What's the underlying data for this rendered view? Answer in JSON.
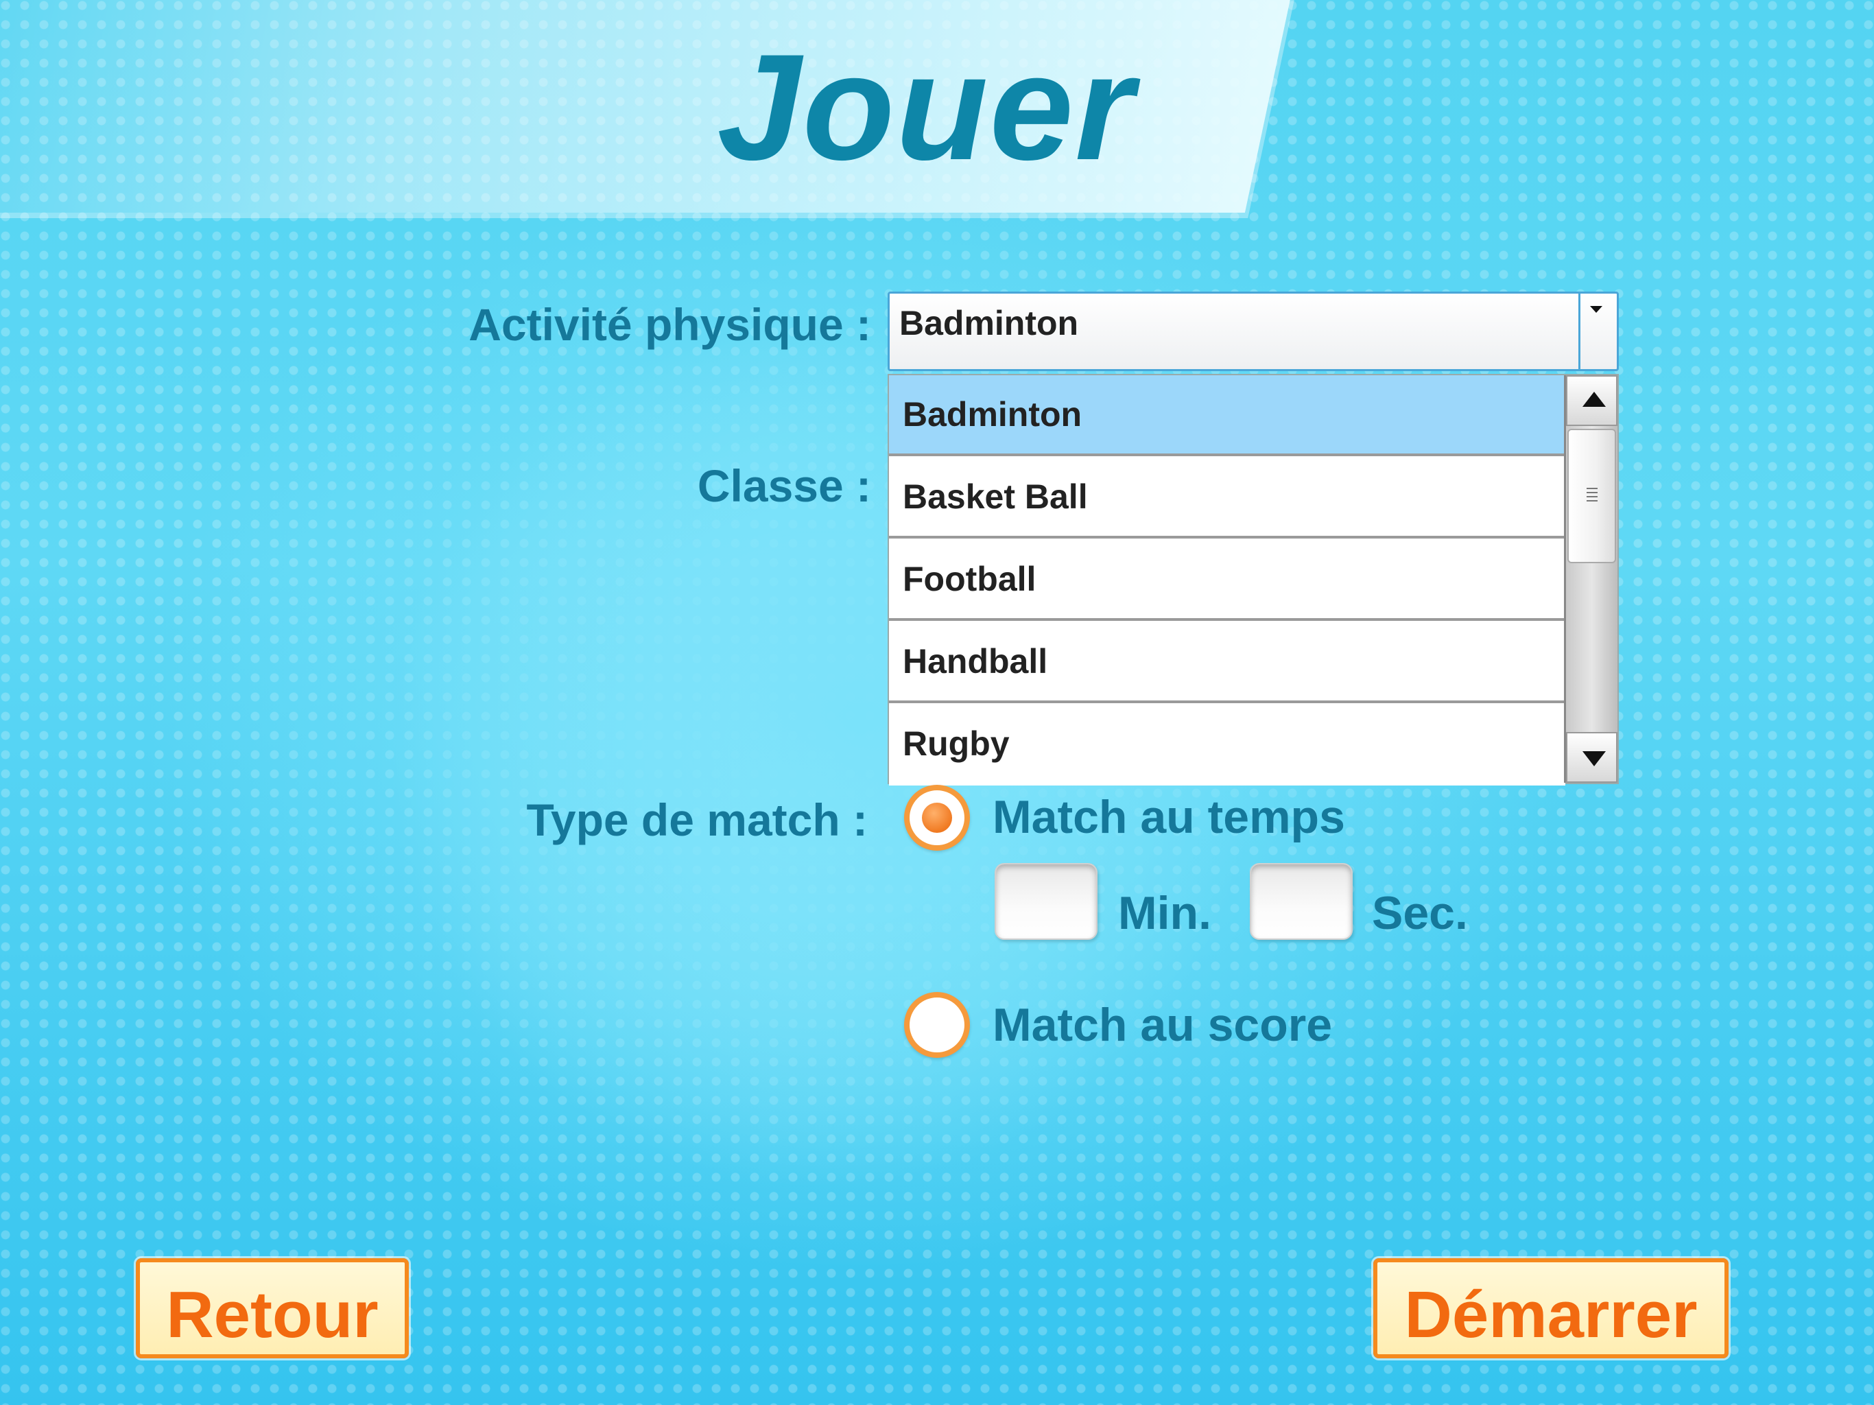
{
  "header": {
    "title": "Jouer"
  },
  "form": {
    "activity_label": "Activité physique :",
    "class_label": "Classe :",
    "match_type_label": "Type de match :"
  },
  "activity_select": {
    "selected": "Badminton",
    "options": [
      "Badminton",
      "Basket Ball",
      "Football",
      "Handball",
      "Rugby"
    ]
  },
  "match_type": {
    "time_option": "Match au temps",
    "score_option": "Match au score",
    "selected": "Match au temps",
    "minutes_unit": "Min.",
    "seconds_unit": "Sec.",
    "minutes_value": "",
    "seconds_value": ""
  },
  "footer": {
    "back_label": "Retour",
    "start_label": "Démarrer"
  },
  "colors": {
    "title": "#0e86a8",
    "label": "#15789a",
    "accent_orange": "#f58a1e",
    "selected_row": "#9cd7fa"
  },
  "icons": [
    "dropdown-arrow-icon",
    "scroll-up-icon",
    "scroll-down-icon",
    "scroll-grip-icon"
  ]
}
